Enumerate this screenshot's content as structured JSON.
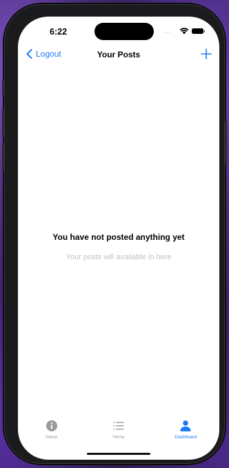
{
  "status_bar": {
    "time": "6:22",
    "signal": "....",
    "icons": [
      "wifi-icon",
      "battery-icon"
    ]
  },
  "nav": {
    "back_label": "Logout",
    "back_icon": "chevron-left-icon",
    "title": "Your Posts",
    "add_icon": "plus-icon"
  },
  "empty_state": {
    "title": "You have not posted anything yet",
    "subtitle": "Your posts will available in here"
  },
  "tab_bar": {
    "items": [
      {
        "label": "About",
        "icon": "info-icon",
        "active": false
      },
      {
        "label": "Home",
        "icon": "list-icon",
        "active": false
      },
      {
        "label": "Dashboard",
        "icon": "person-icon",
        "active": true
      }
    ]
  },
  "colors": {
    "accent": "#1b7bf2",
    "inactive": "#9a9a9e",
    "subtitle": "#c2c2c6"
  }
}
